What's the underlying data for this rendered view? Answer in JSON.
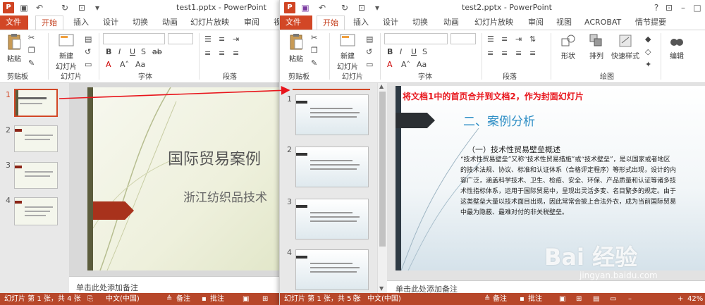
{
  "window1": {
    "title": "test1.pptx - PowerPoint",
    "tabs": [
      "文件",
      "开始",
      "插入",
      "设计",
      "切换",
      "动画",
      "幻灯片放映",
      "审阅",
      "视"
    ],
    "ribbon": {
      "paste": "粘贴",
      "new_slide_line1": "新建",
      "new_slide_line2": "幻灯片",
      "groups": [
        "剪贴板",
        "幻灯片",
        "字体",
        "段落"
      ]
    },
    "slide_numbers": [
      "1",
      "2",
      "3",
      "4"
    ],
    "slide_title": "国际贸易案例",
    "slide_subtitle": "浙江纺织品技术",
    "notes": "单击此处添加备注",
    "status": {
      "slide_info": "幻灯片 第 1 张，共 4 张",
      "lang": "中文(中国)",
      "notes_btn": "备注",
      "comments_btn": "批注"
    }
  },
  "window2": {
    "title": "test2.pptx - PowerPoint",
    "tabs": [
      "文件",
      "开始",
      "插入",
      "设计",
      "切换",
      "动画",
      "幻灯片放映",
      "审阅",
      "视图",
      "ACROBAT",
      "情节提要"
    ],
    "ribbon": {
      "paste": "粘贴",
      "new_slide_line1": "新建",
      "new_slide_line2": "幻灯片",
      "shape": "形状",
      "arrange": "排列",
      "quick_styles": "快速样式",
      "edit": "编辑",
      "groups": [
        "剪贴板",
        "幻灯片",
        "字体",
        "段落",
        "绘图"
      ]
    },
    "slide_numbers": [
      "1",
      "2",
      "3",
      "4"
    ],
    "annotation": "将文档1中的首页合并到文档2，作为封面幻灯片",
    "slide_heading": "二、案例分析",
    "slide_subheading": "（一）技术性贸易壁垒概述",
    "slide_body": "“技术性贸易壁垒”又称“技术性贸易措施”或“技术壁垒”，是以国家或者地区的技术法规、协议、标准和认证体系（合格评定程序）等形式出现，设计的内容广泛，涵盖科学技术、卫生、检疫、安全、环保、产品质量和认证等诸多技术性指标体系，运用于国际贸易中，呈现出灵活多变、名目繁多的规定。由于这类壁垒大量以技术面目出现，因此常常会披上合法外衣，成为当前国际贸易中最为隐蔽、最难对付的非关税壁垒。",
    "notes": "单击此处添加备注",
    "status": {
      "slide_info": "幻灯片 第 1 张，共 5 张",
      "lang": "中文(中国)",
      "notes_btn": "备注",
      "comments_btn": "批注",
      "zoom": "42%"
    }
  },
  "watermark": {
    "logo": "Bai 经验",
    "url": "jingyan.baidu.com"
  },
  "colors": {
    "accent": "#d24726",
    "status_bar": "#b7472a",
    "annotation": "#e8141b",
    "heading_blue": "#2e8ec5"
  }
}
